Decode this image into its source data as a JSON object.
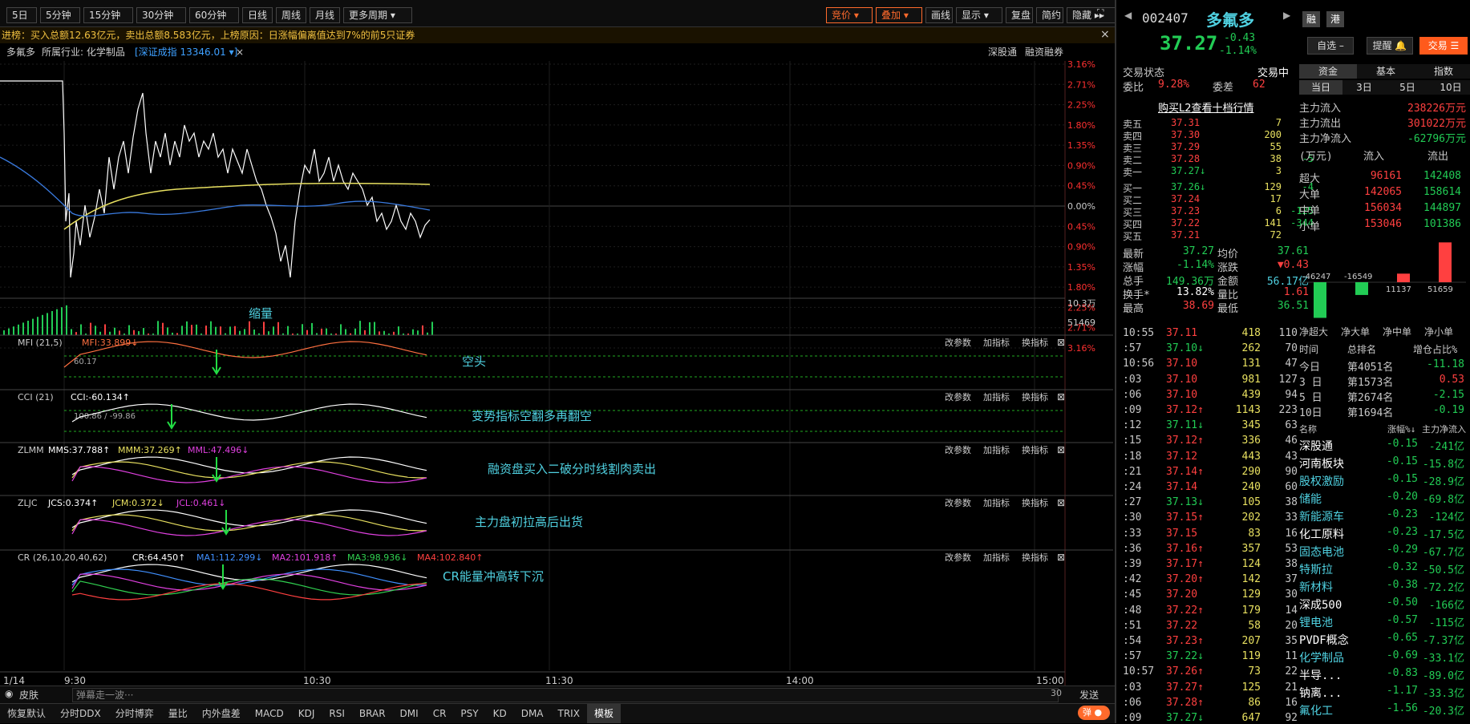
{
  "toolbar": {
    "periods": [
      "5日",
      "5分钟",
      "15分钟",
      "30分钟",
      "60分钟",
      "日线",
      "周线",
      "月线",
      "更多周期 ▾"
    ],
    "right": [
      "竞价 ▾",
      "叠加 ▾",
      "画线",
      "显示 ▾",
      "复盘",
      "简约",
      "隐藏 ▸▸"
    ]
  },
  "ticker": "进榜：买入总额12.63亿元，卖出总额8.583亿元，上榜原因：日涨幅偏离值达到7%的前5只证券",
  "info": {
    "name": "多氟多",
    "industry": "所属行业: 化学制品",
    "index": "[深证成指 13346.01 ▾]",
    "close": "×",
    "links": [
      "深股通",
      "融资融券"
    ]
  },
  "price_axis": [
    "3.16%",
    "2.71%",
    "2.25%",
    "1.80%",
    "1.35%",
    "0.90%",
    "0.45%",
    "0.00%",
    "0.45%",
    "0.90%",
    "1.35%",
    "1.80%",
    "2.25%",
    "2.71%",
    "3.16%"
  ],
  "vol_axis": [
    "10.3万",
    "51469"
  ],
  "time_axis": [
    "1/14",
    "9:30",
    "10:30",
    "11:30",
    "14:00",
    "15:00"
  ],
  "panes": [
    {
      "name": "MFI (21,5)",
      "vals": [
        {
          "t": "MFI:33.899↓",
          "c": "#ff7040"
        }
      ],
      "note": "空头",
      "lvl": "60.17"
    },
    {
      "name": "CCI (21)",
      "vals": [
        {
          "t": "CCI:-60.134↑",
          "c": "#ffffff"
        }
      ],
      "note": "变势指标空翻多再翻空",
      "lvl": "100.86 / -99.86"
    },
    {
      "name": "ZLMM",
      "vals": [
        {
          "t": "MMS:37.788↑",
          "c": "#ffffff"
        },
        {
          "t": "MMM:37.269↑",
          "c": "#e8e060"
        },
        {
          "t": "MML:47.496↓",
          "c": "#e040e0"
        }
      ],
      "note": "融资盘买入二破分时线割肉卖出"
    },
    {
      "name": "ZLJC",
      "vals": [
        {
          "t": "JCS:0.374↑",
          "c": "#ffffff"
        },
        {
          "t": "JCM:0.372↓",
          "c": "#e8e060"
        },
        {
          "t": "JCL:0.461↓",
          "c": "#e040e0"
        }
      ],
      "note": "主力盘初拉高后出货"
    },
    {
      "name": "CR (26,10,20,40,62)",
      "vals": [
        {
          "t": "CR:64.450↑",
          "c": "#ffffff"
        },
        {
          "t": "MA1:112.299↓",
          "c": "#4090ff"
        },
        {
          "t": "MA2:101.918↑",
          "c": "#e040e0"
        },
        {
          "t": "MA3:98.936↓",
          "c": "#30d050"
        },
        {
          "t": "MA4:102.840↑",
          "c": "#ff4040"
        }
      ],
      "note": "CR能量冲高转下沉"
    }
  ],
  "pane_btns": [
    "改参数",
    "加指标",
    "换指标"
  ],
  "vol_note": "缩量",
  "bottom": {
    "skin": "皮肤",
    "danmu": "弹幕走一波···",
    "count": "30",
    "send": "发送",
    "toggle": "弹"
  },
  "tabs": [
    "恢复默认",
    "分时DDX",
    "分时博弈",
    "量比",
    "内外盘差",
    "MACD",
    "KDJ",
    "RSI",
    "BRAR",
    "DMI",
    "CR",
    "PSY",
    "KD",
    "DMA",
    "TRIX",
    "模板"
  ],
  "stock": {
    "code": "002407",
    "name": "多氟多",
    "price": "37.27",
    "chg": "-0.43",
    "pct": "-1.14%",
    "btns": [
      "融",
      "港"
    ],
    "sel": "自选 –",
    "alert": "提醒 🔔",
    "trade": "交易 ☰"
  },
  "status": {
    "label": "交易状态",
    "value": "交易中",
    "wb_l": "委比",
    "wb": "9.28%",
    "wc_l": "委差",
    "wc": "62",
    "l2": "购买L2查看十档行情"
  },
  "asks": [
    [
      "卖五",
      "37.31",
      "7",
      ""
    ],
    [
      "卖四",
      "37.30",
      "200",
      ""
    ],
    [
      "卖三",
      "37.29",
      "55",
      ""
    ],
    [
      "卖二",
      "37.28",
      "38",
      "-5"
    ],
    [
      "卖一",
      "37.27↓",
      "3",
      ""
    ]
  ],
  "bids": [
    [
      "买一",
      "37.26↓",
      "129",
      "-4"
    ],
    [
      "买二",
      "37.24",
      "17",
      ""
    ],
    [
      "买三",
      "37.23",
      "6",
      "-125"
    ],
    [
      "买四",
      "37.22",
      "141",
      "-344"
    ],
    [
      "买五",
      "37.21",
      "72",
      ""
    ]
  ],
  "stats": [
    [
      "最新",
      "37.27",
      "均价",
      "37.61"
    ],
    [
      "涨幅",
      "-1.14%",
      "涨跌",
      "▼0.43"
    ],
    [
      "总手",
      "149.36万",
      "金额",
      "56.17亿"
    ],
    [
      "换手*",
      "13.82%",
      "量比",
      "1.61"
    ],
    [
      "最高",
      "38.69",
      "最低",
      "36.51"
    ]
  ],
  "ticks": [
    [
      "10:55",
      "37.11",
      "418",
      "110"
    ],
    [
      ":57",
      "37.10↓",
      "262",
      "70"
    ],
    [
      "10:56",
      "37.10",
      "131",
      "47"
    ],
    [
      ":03",
      "37.10",
      "981",
      "127"
    ],
    [
      ":06",
      "37.10",
      "439",
      "94"
    ],
    [
      ":09",
      "37.12↑",
      "1143",
      "223"
    ],
    [
      ":12",
      "37.11↓",
      "345",
      "63"
    ],
    [
      ":15",
      "37.12↑",
      "336",
      "46"
    ],
    [
      ":18",
      "37.12",
      "443",
      "43"
    ],
    [
      ":21",
      "37.14↑",
      "290",
      "90"
    ],
    [
      ":24",
      "37.14",
      "240",
      "60"
    ],
    [
      ":27",
      "37.13↓",
      "105",
      "38"
    ],
    [
      ":30",
      "37.15↑",
      "202",
      "33"
    ],
    [
      ":33",
      "37.15",
      "83",
      "16"
    ],
    [
      ":36",
      "37.16↑",
      "357",
      "53"
    ],
    [
      ":39",
      "37.17↑",
      "124",
      "38"
    ],
    [
      ":42",
      "37.20↑",
      "142",
      "37"
    ],
    [
      ":45",
      "37.20",
      "129",
      "30"
    ],
    [
      ":48",
      "37.22↑",
      "179",
      "14"
    ],
    [
      ":51",
      "37.22",
      "58",
      "20"
    ],
    [
      ":54",
      "37.23↑",
      "207",
      "35"
    ],
    [
      ":57",
      "37.22↓",
      "119",
      "11"
    ],
    [
      "10:57",
      "37.26↑",
      "73",
      "22"
    ],
    [
      ":03",
      "37.27↑",
      "125",
      "21"
    ],
    [
      ":06",
      "37.28↑",
      "86",
      "16"
    ],
    [
      ":09",
      "37.27↓",
      "647",
      "92"
    ]
  ],
  "fund": {
    "tabs": [
      "资金",
      "基本",
      "指数"
    ],
    "dtabs": [
      "当日",
      "3日",
      "5日",
      "10日"
    ],
    "flow": [
      [
        "主力流入",
        "238226万元"
      ],
      [
        "主力流出",
        "301022万元"
      ],
      [
        "主力净流入",
        "-62796万元"
      ]
    ],
    "head": [
      "(万元)",
      "流入",
      "流出"
    ],
    "tbl": [
      [
        "超大",
        "96161",
        "142408"
      ],
      [
        "大单",
        "142065",
        "158614"
      ],
      [
        "中单",
        "156034",
        "144897"
      ],
      [
        "小单",
        "153046",
        "101386"
      ]
    ],
    "bars": [
      {
        "v": -46247,
        "l": "-46247"
      },
      {
        "v": -16549,
        "l": "-16549"
      },
      {
        "v": 11137,
        "l": "11137"
      },
      {
        "v": 51659,
        "l": "51659"
      }
    ],
    "barlabels": [
      "净超大",
      "净大单",
      "净中单",
      "净小单"
    ],
    "rankhead": [
      "时间",
      "总排名",
      "增仓占比%"
    ],
    "rank": [
      [
        "今日",
        "第4051名",
        "-11.18"
      ],
      [
        "3 日",
        "第1573名",
        "0.53"
      ],
      [
        "5 日",
        "第2674名",
        "-2.15"
      ],
      [
        "10日",
        "第1694名",
        "-0.19"
      ]
    ],
    "sechead": [
      "名称",
      "涨幅%↓",
      "主力净流入"
    ],
    "sectors": [
      [
        "深股通",
        "-0.15",
        "-241亿"
      ],
      [
        "河南板块",
        "-0.15",
        "-15.8亿"
      ],
      [
        "股权激励",
        "-0.15",
        "-28.9亿"
      ],
      [
        "储能",
        "-0.20",
        "-69.8亿"
      ],
      [
        "新能源车",
        "-0.23",
        "-124亿"
      ],
      [
        "化工原料",
        "-0.23",
        "-17.5亿"
      ],
      [
        "固态电池",
        "-0.29",
        "-67.7亿"
      ],
      [
        "特斯拉",
        "-0.32",
        "-50.5亿"
      ],
      [
        "新材料",
        "-0.38",
        "-72.2亿"
      ],
      [
        "深成500",
        "-0.50",
        "-166亿"
      ],
      [
        "锂电池",
        "-0.57",
        "-115亿"
      ],
      [
        "PVDF概念",
        "-0.65",
        "-7.37亿"
      ],
      [
        "化学制品",
        "-0.69",
        "-33.1亿"
      ],
      [
        "半导...",
        "-0.83",
        "-89.0亿"
      ],
      [
        "钠离...",
        "-1.17",
        "-33.3亿"
      ],
      [
        "氟化工",
        "-1.56",
        "-20.3亿"
      ]
    ]
  },
  "colors": {
    "up": "#ff4040",
    "down": "#22cc55",
    "cyan": "#4fd0e0",
    "orange": "#ff6a2c"
  }
}
